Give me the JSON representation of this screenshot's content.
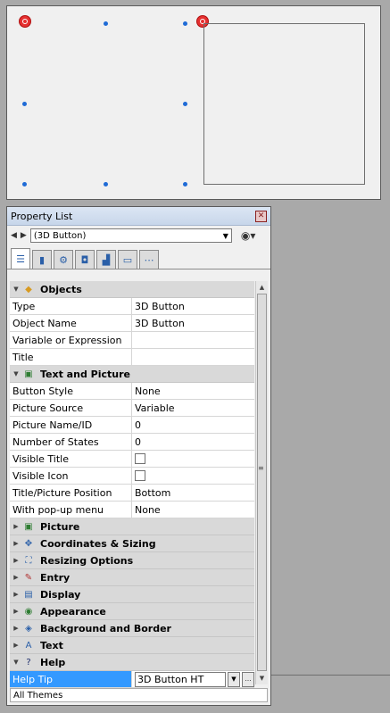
{
  "panel": {
    "title": "Property List",
    "selector": "(3D Button)",
    "tabs": [
      "list-icon",
      "object-icon",
      "gear-icon",
      "form-icon",
      "chart-icon",
      "display-icon",
      "more-icon"
    ],
    "status": "All Themes"
  },
  "sections": [
    {
      "label": "Objects",
      "expanded": true,
      "props": [
        {
          "key": "Type",
          "value": "3D Button"
        },
        {
          "key": "Object Name",
          "value": "3D Button"
        },
        {
          "key": "Variable or Expression",
          "value": ""
        },
        {
          "key": "Title",
          "value": ""
        }
      ]
    },
    {
      "label": "Text and Picture",
      "expanded": true,
      "props": [
        {
          "key": "Button Style",
          "value": "None"
        },
        {
          "key": "Picture Source",
          "value": "Variable"
        },
        {
          "key": "Picture Name/ID",
          "value": "0"
        },
        {
          "key": "Number of States",
          "value": "0"
        },
        {
          "key": "Visible Title",
          "value": "",
          "checkbox": true
        },
        {
          "key": "Visible Icon",
          "value": "",
          "checkbox": true
        },
        {
          "key": "Title/Picture Position",
          "value": "Bottom"
        },
        {
          "key": "With pop-up menu",
          "value": "None"
        }
      ]
    },
    {
      "label": "Picture",
      "expanded": false
    },
    {
      "label": "Coordinates & Sizing",
      "expanded": false
    },
    {
      "label": "Resizing Options",
      "expanded": false
    },
    {
      "label": "Entry",
      "expanded": false
    },
    {
      "label": "Display",
      "expanded": false
    },
    {
      "label": "Appearance",
      "expanded": false
    },
    {
      "label": "Background and Border",
      "expanded": false
    },
    {
      "label": "Text",
      "expanded": false
    },
    {
      "label": "Help",
      "expanded": true,
      "props": [
        {
          "key": "Help Tip",
          "value": "3D Button HT",
          "selected": true,
          "editor": true
        }
      ]
    }
  ],
  "colors": {
    "selection": "#3399ff",
    "handle": "#1f6bd6",
    "anchor": "#e53030"
  }
}
